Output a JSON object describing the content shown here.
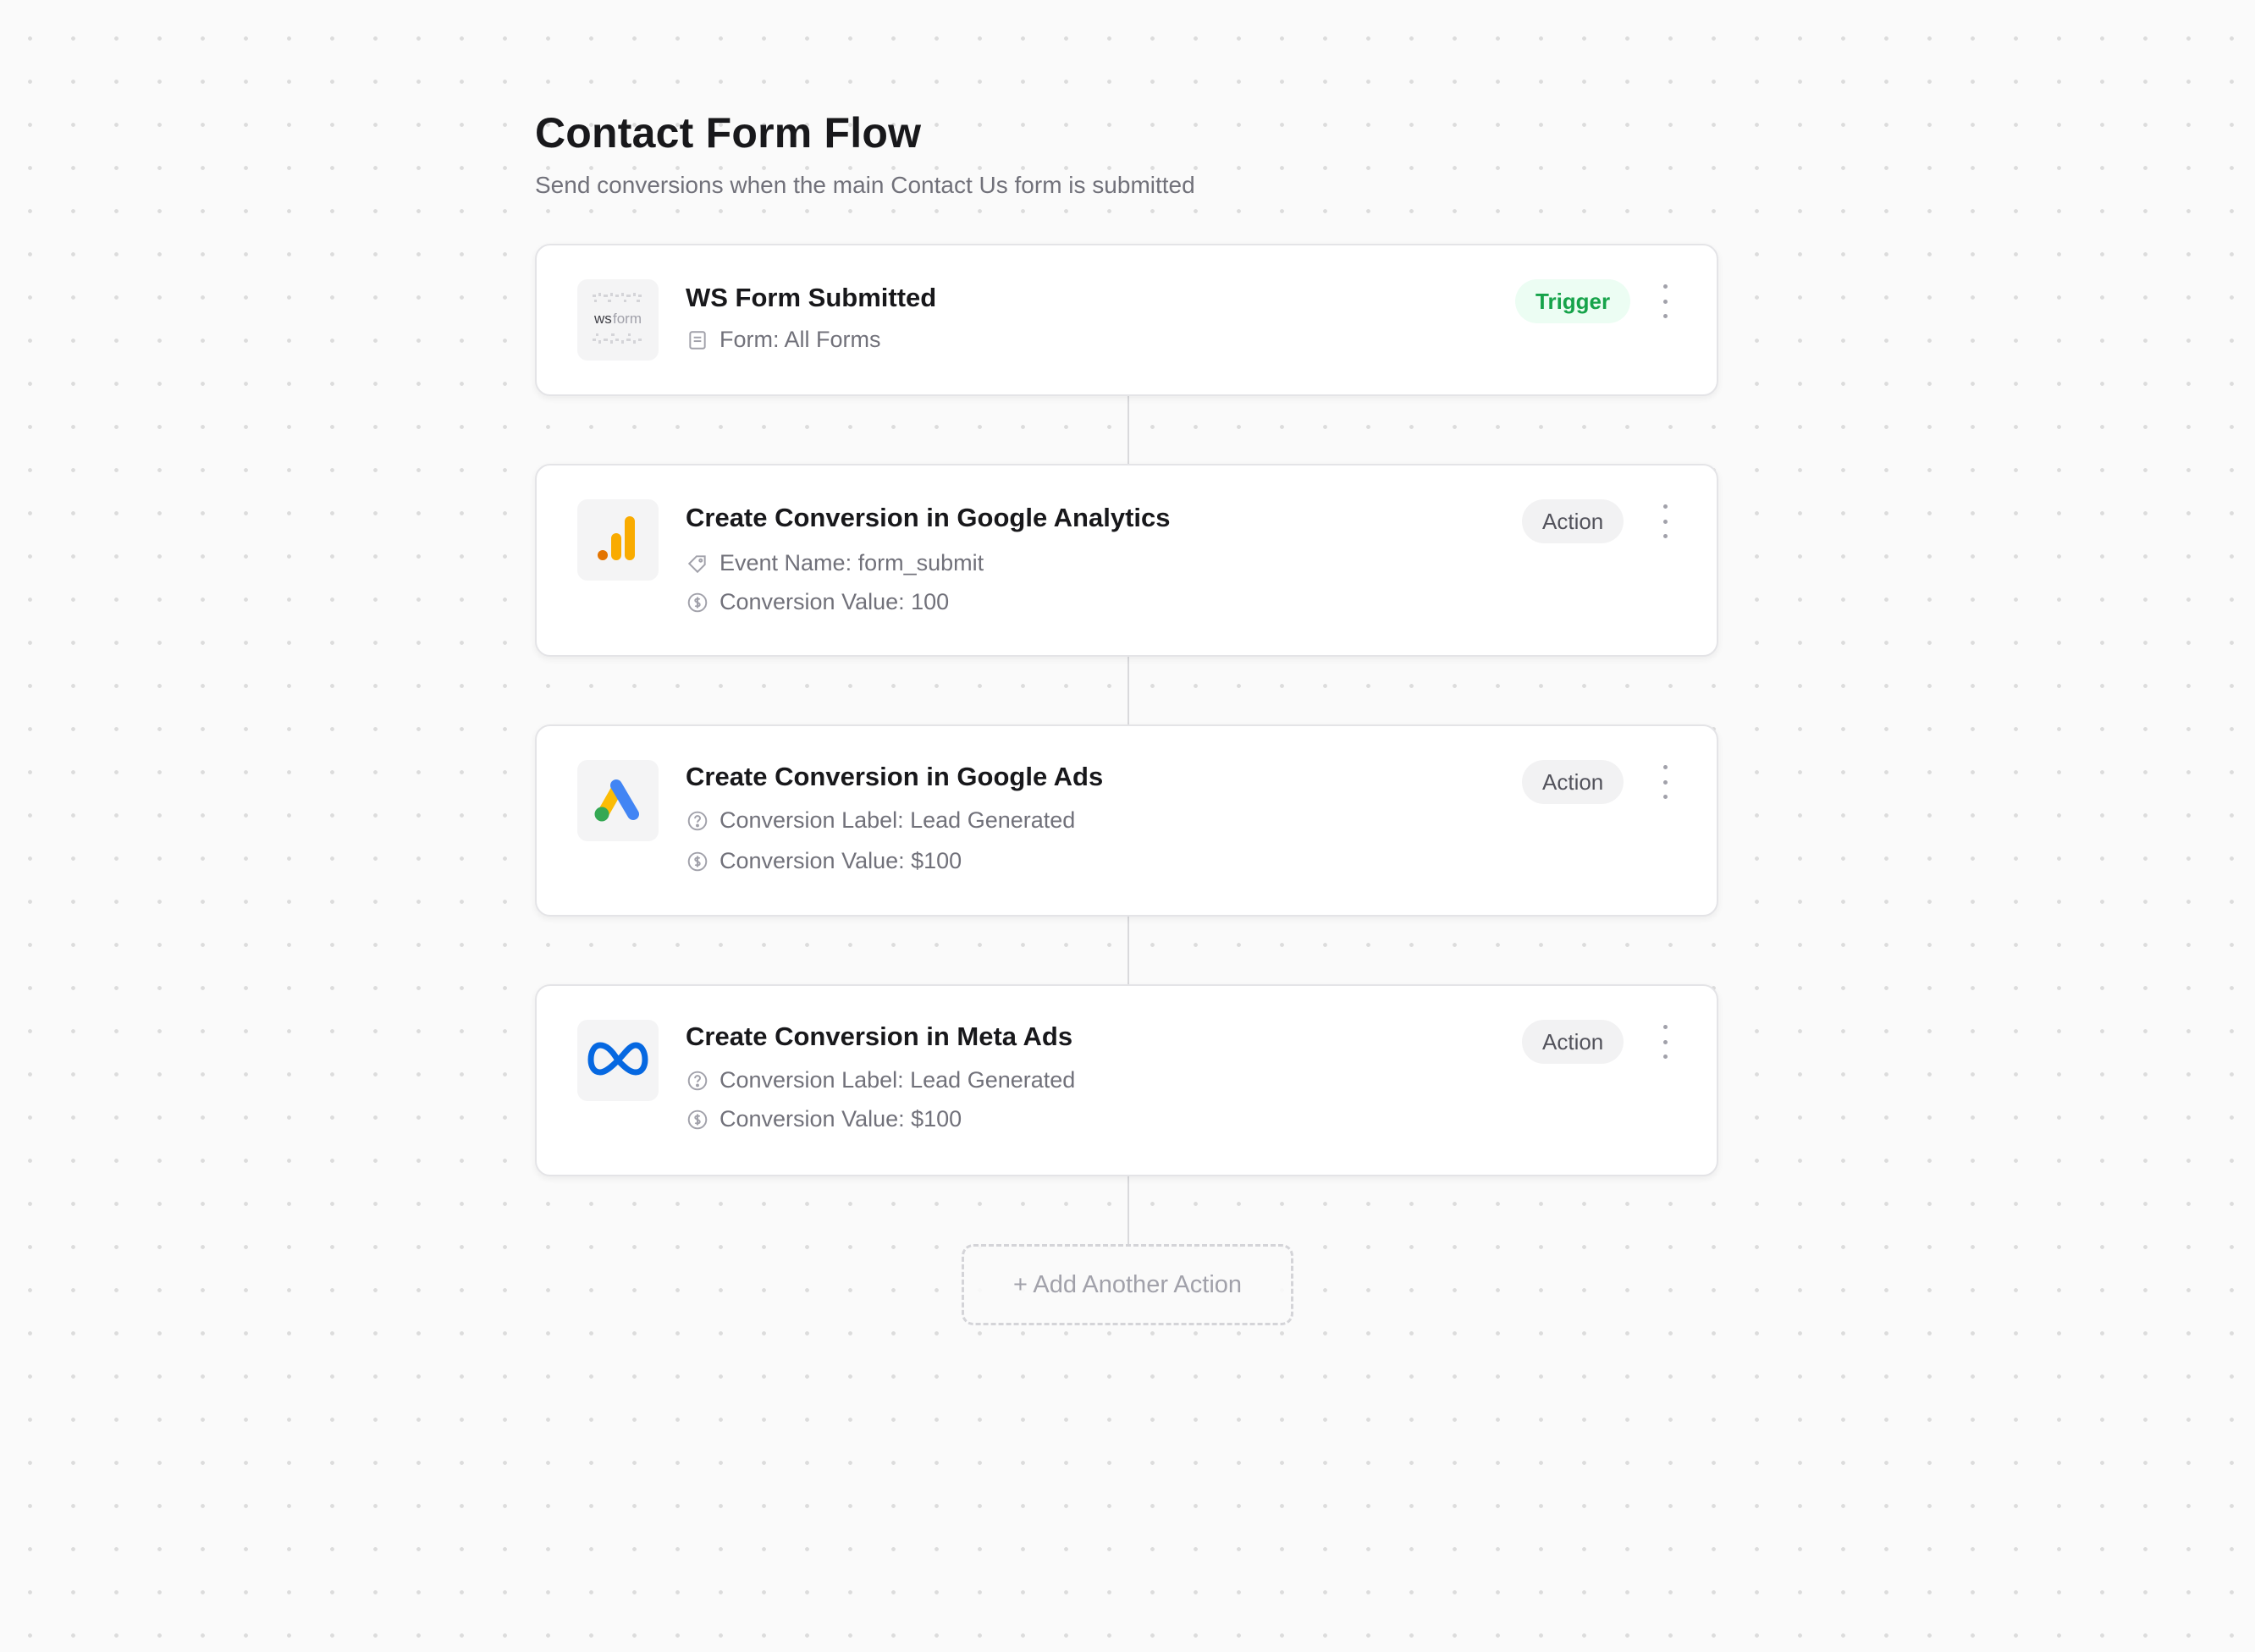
{
  "header": {
    "title": "Contact Form Flow",
    "subtitle": "Send conversions when the main Contact Us form is submitted"
  },
  "steps": [
    {
      "title": "WS Form Submitted",
      "badge": "Trigger",
      "logo": "wsform-logo",
      "logo_text_ws": "ws",
      "logo_text_form": "form",
      "details": [
        {
          "icon": "document-icon",
          "text": "Form: All Forms"
        }
      ]
    },
    {
      "title": "Create Conversion in Google Analytics",
      "badge": "Action",
      "logo": "google-analytics-logo",
      "details": [
        {
          "icon": "tag-icon",
          "text": "Event Name: form_submit"
        },
        {
          "icon": "dollar-circle-icon",
          "text": "Conversion Value: 100"
        }
      ]
    },
    {
      "title": "Create Conversion in Google Ads",
      "badge": "Action",
      "logo": "google-ads-logo",
      "details": [
        {
          "icon": "question-circle-icon",
          "text": "Conversion Label: Lead Generated"
        },
        {
          "icon": "dollar-circle-icon",
          "text": "Conversion Value: $100"
        }
      ]
    },
    {
      "title": "Create Conversion in Meta Ads",
      "badge": "Action",
      "logo": "meta-logo",
      "details": [
        {
          "icon": "question-circle-icon",
          "text": "Conversion Label: Lead Generated"
        },
        {
          "icon": "dollar-circle-icon",
          "text": "Conversion Value: $100"
        }
      ]
    }
  ],
  "add_action_label": "+ Add Another Action",
  "colors": {
    "trigger_text": "#16a34a",
    "trigger_bg": "#ecfdf3",
    "ga_orange": "#f9ab00",
    "ga_dark_orange": "#e37400",
    "ads_blue": "#4285f4",
    "ads_yellow": "#fbbc04",
    "ads_green": "#34a853",
    "meta_blue": "#0668e1"
  }
}
